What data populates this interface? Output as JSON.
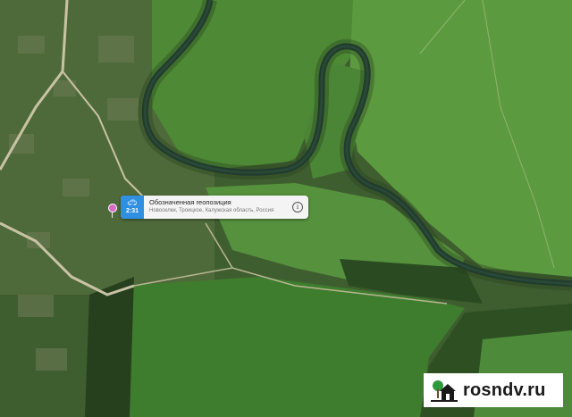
{
  "map": {
    "type": "satellite",
    "feature_labels": [
      "river",
      "village",
      "fields",
      "forest"
    ]
  },
  "callout": {
    "badge_icon": "car-icon",
    "badge_time": "2:31",
    "title": "Обозначенная геопозиция",
    "subtitle": "Новоселки, Троицкое, Калужская область, Россия",
    "info_icon": "i"
  },
  "watermark": {
    "text": "rosndv.ru",
    "icon": "house-tree-icon"
  },
  "colors": {
    "badge": "#2f8fe0",
    "pin": "#d968c8",
    "field_light": "#5f9a42",
    "field_dark": "#3c6b2c",
    "river": "#1f3b35"
  }
}
